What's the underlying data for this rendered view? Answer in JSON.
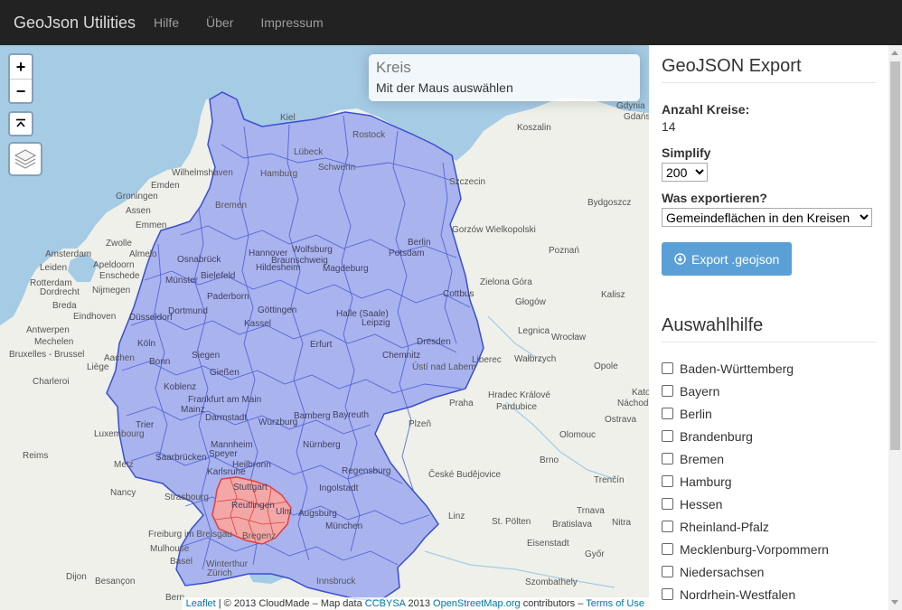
{
  "nav": {
    "brand": "GeoJson Utilities",
    "links": [
      "Hilfe",
      "Über",
      "Impressum"
    ]
  },
  "map": {
    "zoom_in": "+",
    "zoom_out": "−",
    "info": {
      "title": "Kreis",
      "text": "Mit der Maus auswählen"
    },
    "attribution": {
      "leaflet": "Leaflet",
      "part1": " | © 2013 CloudMade – Map data ",
      "ccbysa": "CCBYSA",
      "part2": " 2013 ",
      "osm": "OpenStreetMap.org",
      "part3": " contributors – ",
      "terms": "Terms of Use"
    },
    "labels": {
      "kiel": "Kiel",
      "rostock": "Rostock",
      "luebeck": "Lübeck",
      "wilhelmshaven": "Wilhelmshaven",
      "hamburg": "Hamburg",
      "schwerin": "Schwerin",
      "emden": "Emden",
      "bremen": "Bremen",
      "groningen": "Groningen",
      "assen": "Assen",
      "emmen": "Emmen",
      "zwolle": "Zwolle",
      "almelo": "Almelo",
      "amsterdam": "Amsterdam",
      "apeldoorn": "Apeldoorn",
      "enschede": "Enschede",
      "leiden": "Leiden",
      "rotterdam": "Rotterdam",
      "dordrecht": "Dordrecht",
      "nijmegen": "Nijmegen",
      "breda": "Breda",
      "eindhoven": "Eindhoven",
      "antwerpen": "Antwerpen",
      "mechelen": "Mechelen",
      "bruxelles": "Bruxelles - Brussel",
      "liege": "Liège",
      "aachen": "Aachen",
      "charleroi": "Charleroi",
      "luxembourg": "Luxembourg",
      "metz": "Metz",
      "nancy": "Nancy",
      "reims": "Reims",
      "strasbourg": "Strasbourg",
      "freiburg": "Freiburg im Breisgau",
      "mulhouse": "Mulhouse",
      "basel": "Basel",
      "zurich": "Zürich",
      "winterthur": "Winterthur",
      "dijon": "Dijon",
      "besancon": "Besançon",
      "bern": "Bern",
      "innsbruck": "Innsbruck",
      "osnabrueck": "Osnabrück",
      "muenster": "Münster",
      "bielefeld": "Bielefeld",
      "paderborn": "Paderborn",
      "hannover": "Hannover",
      "wolfsburg": "Wolfsburg",
      "braunschweig": "Braunschweig",
      "hildesheim": "Hildesheim",
      "magdeburg": "Magdeburg",
      "berlin": "Berlin",
      "potsdam": "Potsdam",
      "goettingen": "Göttingen",
      "kassel": "Kassel",
      "halle": "Halle (Saale)",
      "leipzig": "Leipzig",
      "cottbus": "Cottbus",
      "dresden": "Dresden",
      "erfurt": "Erfurt",
      "chemnitz": "Chemnitz",
      "duesseldorf": "Düsseldorf",
      "dortmund": "Dortmund",
      "koeln": "Köln",
      "bonn": "Bonn",
      "koblenz": "Koblenz",
      "siegen": "Siegen",
      "giessen": "Gießen",
      "frankfurt": "Frankfurt am Main",
      "mainz": "Mainz",
      "darmstadt": "Darmstadt",
      "wuerzburg": "Würzburg",
      "trier": "Trier",
      "saarbruecken": "Saarbrücken",
      "mannheim": "Mannheim",
      "speyer": "Speyer",
      "heilbronn": "Heilbronn",
      "karlsruhe": "Karlsruhe",
      "stuttgart": "Stuttgart",
      "reutlingen": "Reutlingen",
      "ulm": "Ulm",
      "augsburg": "Augsburg",
      "muenchen": "München",
      "regensburg": "Regensburg",
      "ingolstadt": "Ingolstadt",
      "nuernberg": "Nürnberg",
      "bamberg": "Bamberg",
      "bayreuth": "Bayreuth",
      "bregenz": "Bregenz",
      "szczecin": "Szczecin",
      "koszalin": "Koszalin",
      "gdynia": "Gdynia",
      "gdansk": "Gdańsk",
      "bydgoszcz": "Bydgoszcz",
      "gorzow": "Gorzów Wielkopolski",
      "poznan": "Poznań",
      "zielona": "Zielona Góra",
      "kalisz": "Kalisz",
      "glogow": "Głogów",
      "legnica": "Legnica",
      "wroclaw": "Wrocław",
      "walbrzych": "Wałbrzych",
      "liberec": "Liberec",
      "usti": "Ústí nad Labem",
      "opole": "Opole",
      "praha": "Praha",
      "hradec": "Hradec Králové",
      "pardubice": "Pardubice",
      "nachod": "Náchod",
      "katowice": "Kato",
      "olomouc": "Olomouc",
      "ostrava": "Ostrava",
      "plzen": "Plzeň",
      "budejovice": "České Budějovice",
      "brno": "Brno",
      "trencin": "Trenčín",
      "linz": "Linz",
      "stpoelten": "St. Pölten",
      "bratislava": "Bratislava",
      "trnava": "Trnava",
      "nitra": "Nitra",
      "eisenstadt": "Eisenstadt",
      "gyor": "Győr",
      "szombathely": "Szombathely"
    }
  },
  "panel": {
    "title": "GeoJSON Export",
    "count_label": "Anzahl Kreise:",
    "count_value": "14",
    "simplify_label": "Simplify",
    "simplify_value": "200",
    "what_label": "Was exportieren?",
    "what_value": "Gemeindeflächen in den Kreisen",
    "export_button": "Export .geojson",
    "helper_title": "Auswahlhilfe",
    "states": [
      "Baden-Württemberg",
      "Bayern",
      "Berlin",
      "Brandenburg",
      "Bremen",
      "Hamburg",
      "Hessen",
      "Rheinland-Pfalz",
      "Mecklenburg-Vorpommern",
      "Niedersachsen",
      "Nordrhein-Westfalen"
    ]
  },
  "colors": {
    "navbar": "#222222",
    "sea": "#a5cbe5",
    "land": "#eef0e9",
    "region_fill": "#a9b3ee",
    "region_stroke": "#3b4fd0",
    "selected_fill": "#f4a7a7",
    "selected_stroke": "#e04040",
    "button": "#5aa0d7"
  }
}
